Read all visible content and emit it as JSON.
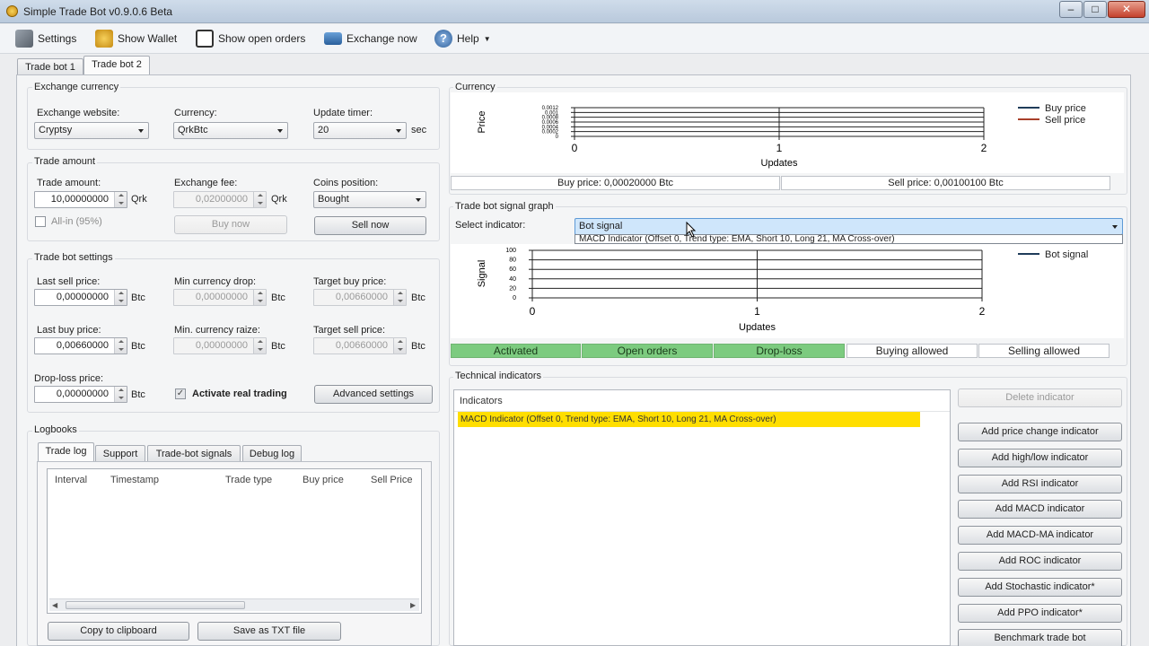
{
  "window": {
    "title": "Simple Trade Bot v0.9.0.6 Beta",
    "min": "–",
    "max": "□",
    "close": "✕"
  },
  "toolbar": {
    "settings": "Settings",
    "wallet": "Show Wallet",
    "orders": "Show open orders",
    "exchange": "Exchange now",
    "help": "Help"
  },
  "tabs": [
    "Trade bot 1",
    "Trade bot 2"
  ],
  "exchange": {
    "group": "Exchange currency",
    "website_label": "Exchange website:",
    "website": "Cryptsy",
    "currency_label": "Currency:",
    "currency": "QrkBtc",
    "timer_label": "Update timer:",
    "timer": "20",
    "timer_unit": "sec"
  },
  "trade_amount": {
    "group": "Trade amount",
    "amount_label": "Trade amount:",
    "amount": "10,00000000",
    "amount_unit": "Qrk",
    "allin_label": "All-in (95%)",
    "fee_label": "Exchange fee:",
    "fee": "0,02000000",
    "fee_unit": "Qrk",
    "buy_now": "Buy now",
    "coins_label": "Coins position:",
    "coins": "Bought",
    "sell_now": "Sell now"
  },
  "settings": {
    "group": "Trade bot settings",
    "last_sell_label": "Last sell price:",
    "last_sell": "0,00000000",
    "min_drop_label": "Min currency drop:",
    "min_drop": "0,00000000",
    "target_buy_label": "Target buy price:",
    "target_buy": "0,00660000",
    "last_buy_label": "Last buy price:",
    "last_buy": "0,00660000",
    "min_raise_label": "Min. currency raize:",
    "min_raise": "0,00000000",
    "target_sell_label": "Target sell price:",
    "target_sell": "0,00660000",
    "drop_loss_label": "Drop-loss price:",
    "drop_loss": "0,00000000",
    "activate_label": "Activate real trading",
    "advanced": "Advanced settings",
    "unit": "Btc"
  },
  "logbooks": {
    "group": "Logbooks",
    "tabs": [
      "Trade log",
      "Support",
      "Trade-bot signals",
      "Debug log"
    ],
    "columns": [
      "Interval",
      "Timestamp",
      "Trade type",
      "Buy price",
      "Sell Price"
    ],
    "copy": "Copy to clipboard",
    "save": "Save as TXT file"
  },
  "currency_chart": {
    "group": "Currency",
    "buy_price": "Buy price: 0,00020000 Btc",
    "sell_price": "Sell price: 0,00100100 Btc"
  },
  "signal": {
    "group": "Trade bot signal graph",
    "select_label": "Select indicator:",
    "selected": "Bot signal",
    "option": "MACD Indicator (Offset 0, Trend type: EMA, Short 10, Long 21, MA Cross-over)"
  },
  "status": [
    "Activated",
    "Open orders",
    "Drop-loss",
    "Buying allowed",
    "Selling allowed"
  ],
  "technical": {
    "group": "Technical indicators",
    "list_header": "Indicators",
    "items": [
      "MACD Indicator (Offset 0, Trend type: EMA, Short 10, Long 21, MA Cross-over)"
    ],
    "delete": "Delete indicator",
    "buttons": [
      "Add price change indicator",
      "Add high/low indicator",
      "Add RSI indicator",
      "Add MACD indicator",
      "Add MACD-MA indicator",
      "Add ROC indicator",
      "Add Stochastic indicator*",
      "Add PPO indicator*",
      "Benchmark trade bot"
    ]
  },
  "chart_data": [
    {
      "type": "line",
      "ylabel": "Price",
      "xlabel": "Updates",
      "x_ticks": [
        "0",
        "1",
        "2"
      ],
      "y_ticks": [
        "0.0012",
        "0.001",
        "0.0008",
        "0.0006",
        "0.0004",
        "0.0002",
        "0"
      ],
      "ylim": [
        0,
        0.0012
      ],
      "series": [
        {
          "name": "Buy price",
          "color": "#1f3c5a"
        },
        {
          "name": "Sell price",
          "color": "#a8402a"
        }
      ],
      "legend": "top-right"
    },
    {
      "type": "line",
      "ylabel": "Signal",
      "xlabel": "Updates",
      "x_ticks": [
        "0",
        "1",
        "2"
      ],
      "y_ticks": [
        "100",
        "80",
        "60",
        "40",
        "20",
        "0"
      ],
      "ylim": [
        0,
        100
      ],
      "series": [
        {
          "name": "Bot signal",
          "color": "#1f3c5a"
        }
      ],
      "legend": "top-right"
    }
  ]
}
